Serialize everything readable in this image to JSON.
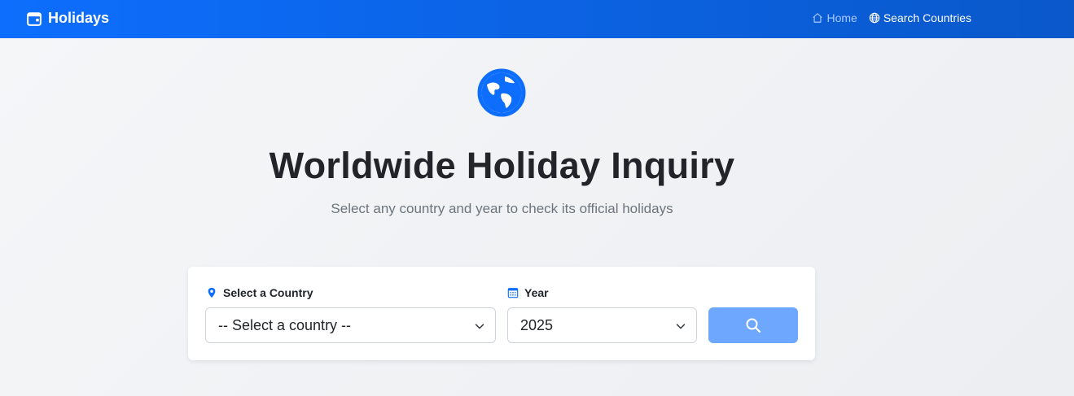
{
  "navbar": {
    "brand": "Holidays",
    "links": [
      {
        "label": "Home",
        "icon": "house-icon"
      },
      {
        "label": "Search Countries",
        "icon": "globe-icon"
      }
    ]
  },
  "hero": {
    "icon": "globe-americas-icon",
    "title": "Worldwide Holiday Inquiry",
    "subtitle": "Select any country and year to check its official holidays"
  },
  "form": {
    "country_label": "Select a Country",
    "country_value": "-- Select a country --",
    "year_label": "Year",
    "year_value": "2025",
    "search_icon": "search-icon"
  },
  "colors": {
    "primary": "#0d6efd",
    "button": "#6ea8fe"
  }
}
